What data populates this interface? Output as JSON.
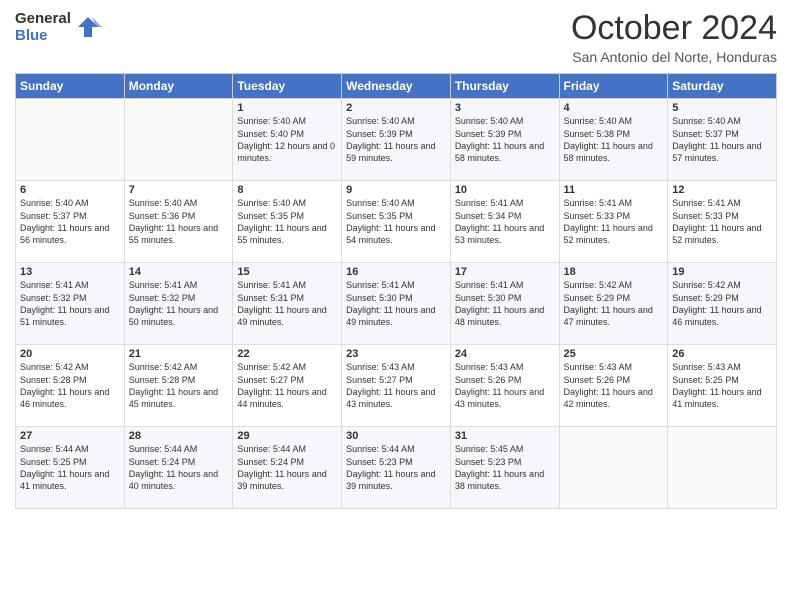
{
  "logo": {
    "line1": "General",
    "line2": "Blue"
  },
  "header": {
    "month": "October 2024",
    "location": "San Antonio del Norte, Honduras"
  },
  "weekdays": [
    "Sunday",
    "Monday",
    "Tuesday",
    "Wednesday",
    "Thursday",
    "Friday",
    "Saturday"
  ],
  "weeks": [
    [
      {
        "day": "",
        "sunrise": "",
        "sunset": "",
        "daylight": ""
      },
      {
        "day": "",
        "sunrise": "",
        "sunset": "",
        "daylight": ""
      },
      {
        "day": "1",
        "sunrise": "Sunrise: 5:40 AM",
        "sunset": "Sunset: 5:40 PM",
        "daylight": "Daylight: 12 hours and 0 minutes."
      },
      {
        "day": "2",
        "sunrise": "Sunrise: 5:40 AM",
        "sunset": "Sunset: 5:39 PM",
        "daylight": "Daylight: 11 hours and 59 minutes."
      },
      {
        "day": "3",
        "sunrise": "Sunrise: 5:40 AM",
        "sunset": "Sunset: 5:39 PM",
        "daylight": "Daylight: 11 hours and 58 minutes."
      },
      {
        "day": "4",
        "sunrise": "Sunrise: 5:40 AM",
        "sunset": "Sunset: 5:38 PM",
        "daylight": "Daylight: 11 hours and 58 minutes."
      },
      {
        "day": "5",
        "sunrise": "Sunrise: 5:40 AM",
        "sunset": "Sunset: 5:37 PM",
        "daylight": "Daylight: 11 hours and 57 minutes."
      }
    ],
    [
      {
        "day": "6",
        "sunrise": "Sunrise: 5:40 AM",
        "sunset": "Sunset: 5:37 PM",
        "daylight": "Daylight: 11 hours and 56 minutes."
      },
      {
        "day": "7",
        "sunrise": "Sunrise: 5:40 AM",
        "sunset": "Sunset: 5:36 PM",
        "daylight": "Daylight: 11 hours and 55 minutes."
      },
      {
        "day": "8",
        "sunrise": "Sunrise: 5:40 AM",
        "sunset": "Sunset: 5:35 PM",
        "daylight": "Daylight: 11 hours and 55 minutes."
      },
      {
        "day": "9",
        "sunrise": "Sunrise: 5:40 AM",
        "sunset": "Sunset: 5:35 PM",
        "daylight": "Daylight: 11 hours and 54 minutes."
      },
      {
        "day": "10",
        "sunrise": "Sunrise: 5:41 AM",
        "sunset": "Sunset: 5:34 PM",
        "daylight": "Daylight: 11 hours and 53 minutes."
      },
      {
        "day": "11",
        "sunrise": "Sunrise: 5:41 AM",
        "sunset": "Sunset: 5:33 PM",
        "daylight": "Daylight: 11 hours and 52 minutes."
      },
      {
        "day": "12",
        "sunrise": "Sunrise: 5:41 AM",
        "sunset": "Sunset: 5:33 PM",
        "daylight": "Daylight: 11 hours and 52 minutes."
      }
    ],
    [
      {
        "day": "13",
        "sunrise": "Sunrise: 5:41 AM",
        "sunset": "Sunset: 5:32 PM",
        "daylight": "Daylight: 11 hours and 51 minutes."
      },
      {
        "day": "14",
        "sunrise": "Sunrise: 5:41 AM",
        "sunset": "Sunset: 5:32 PM",
        "daylight": "Daylight: 11 hours and 50 minutes."
      },
      {
        "day": "15",
        "sunrise": "Sunrise: 5:41 AM",
        "sunset": "Sunset: 5:31 PM",
        "daylight": "Daylight: 11 hours and 49 minutes."
      },
      {
        "day": "16",
        "sunrise": "Sunrise: 5:41 AM",
        "sunset": "Sunset: 5:30 PM",
        "daylight": "Daylight: 11 hours and 49 minutes."
      },
      {
        "day": "17",
        "sunrise": "Sunrise: 5:41 AM",
        "sunset": "Sunset: 5:30 PM",
        "daylight": "Daylight: 11 hours and 48 minutes."
      },
      {
        "day": "18",
        "sunrise": "Sunrise: 5:42 AM",
        "sunset": "Sunset: 5:29 PM",
        "daylight": "Daylight: 11 hours and 47 minutes."
      },
      {
        "day": "19",
        "sunrise": "Sunrise: 5:42 AM",
        "sunset": "Sunset: 5:29 PM",
        "daylight": "Daylight: 11 hours and 46 minutes."
      }
    ],
    [
      {
        "day": "20",
        "sunrise": "Sunrise: 5:42 AM",
        "sunset": "Sunset: 5:28 PM",
        "daylight": "Daylight: 11 hours and 46 minutes."
      },
      {
        "day": "21",
        "sunrise": "Sunrise: 5:42 AM",
        "sunset": "Sunset: 5:28 PM",
        "daylight": "Daylight: 11 hours and 45 minutes."
      },
      {
        "day": "22",
        "sunrise": "Sunrise: 5:42 AM",
        "sunset": "Sunset: 5:27 PM",
        "daylight": "Daylight: 11 hours and 44 minutes."
      },
      {
        "day": "23",
        "sunrise": "Sunrise: 5:43 AM",
        "sunset": "Sunset: 5:27 PM",
        "daylight": "Daylight: 11 hours and 43 minutes."
      },
      {
        "day": "24",
        "sunrise": "Sunrise: 5:43 AM",
        "sunset": "Sunset: 5:26 PM",
        "daylight": "Daylight: 11 hours and 43 minutes."
      },
      {
        "day": "25",
        "sunrise": "Sunrise: 5:43 AM",
        "sunset": "Sunset: 5:26 PM",
        "daylight": "Daylight: 11 hours and 42 minutes."
      },
      {
        "day": "26",
        "sunrise": "Sunrise: 5:43 AM",
        "sunset": "Sunset: 5:25 PM",
        "daylight": "Daylight: 11 hours and 41 minutes."
      }
    ],
    [
      {
        "day": "27",
        "sunrise": "Sunrise: 5:44 AM",
        "sunset": "Sunset: 5:25 PM",
        "daylight": "Daylight: 11 hours and 41 minutes."
      },
      {
        "day": "28",
        "sunrise": "Sunrise: 5:44 AM",
        "sunset": "Sunset: 5:24 PM",
        "daylight": "Daylight: 11 hours and 40 minutes."
      },
      {
        "day": "29",
        "sunrise": "Sunrise: 5:44 AM",
        "sunset": "Sunset: 5:24 PM",
        "daylight": "Daylight: 11 hours and 39 minutes."
      },
      {
        "day": "30",
        "sunrise": "Sunrise: 5:44 AM",
        "sunset": "Sunset: 5:23 PM",
        "daylight": "Daylight: 11 hours and 39 minutes."
      },
      {
        "day": "31",
        "sunrise": "Sunrise: 5:45 AM",
        "sunset": "Sunset: 5:23 PM",
        "daylight": "Daylight: 11 hours and 38 minutes."
      },
      {
        "day": "",
        "sunrise": "",
        "sunset": "",
        "daylight": ""
      },
      {
        "day": "",
        "sunrise": "",
        "sunset": "",
        "daylight": ""
      }
    ]
  ]
}
